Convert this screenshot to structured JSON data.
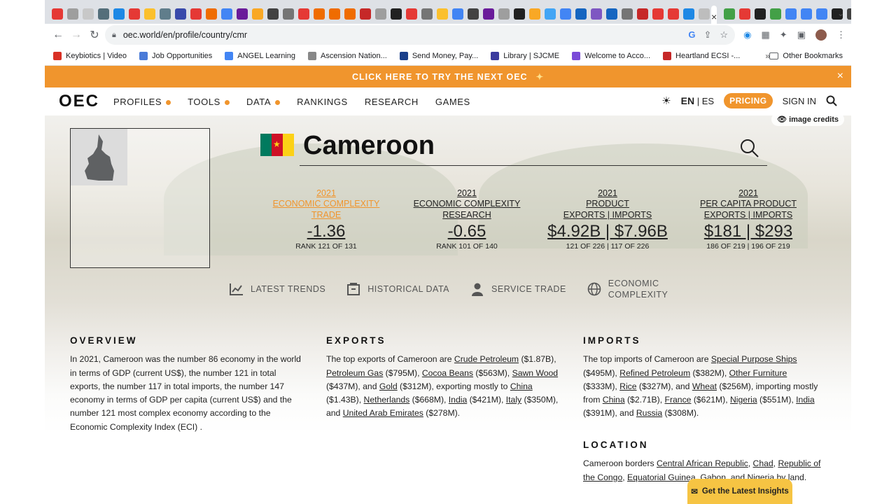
{
  "browser": {
    "active_tab_close": "×",
    "new_tab": "+",
    "tab_menu": "⌄",
    "url": "oec.world/en/profile/country/cmr",
    "bookmarks": [
      {
        "label": "Keybiotics | Video",
        "color": "#d93025"
      },
      {
        "label": "Job Opportunities",
        "color": "#4a7bd8"
      },
      {
        "label": "ANGEL Learning",
        "color": "#4285f4"
      },
      {
        "label": "Ascension Nation...",
        "color": "#888888"
      },
      {
        "label": "Send Money, Pay...",
        "color": "#1a3f8a"
      },
      {
        "label": "Library | SJCME",
        "color": "#3b3b9e"
      },
      {
        "label": "Welcome to Acco...",
        "color": "#7b4bd8"
      },
      {
        "label": "Heartland ECSI -...",
        "color": "#c62828"
      }
    ],
    "bookmarks_more": "»",
    "other_bookmarks": "Other Bookmarks"
  },
  "banner": {
    "text": "CLICK HERE TO TRY THE NEXT OEC",
    "close": "×"
  },
  "nav": {
    "logo": "OEC",
    "links": [
      "PROFILES",
      "TOOLS",
      "DATA",
      "RANKINGS",
      "RESEARCH",
      "GAMES"
    ],
    "lang_active": "EN",
    "lang_sep": " | ",
    "lang_other": "ES",
    "pricing": "PRICING",
    "sign_in": "SIGN IN"
  },
  "hero": {
    "image_credits": "image credits",
    "country": "Cameroon",
    "stats": [
      {
        "year": "2021",
        "label1": "ECONOMIC COMPLEXITY",
        "label2": "TRADE",
        "label3": "",
        "value": "-1.36",
        "rank": "RANK 121 OF 131",
        "active": true
      },
      {
        "year": "2021",
        "label1": "ECONOMIC COMPLEXITY",
        "label2": "RESEARCH",
        "label3": "",
        "value": "-0.65",
        "rank": "RANK 101 OF 140",
        "active": false
      },
      {
        "year": "2021",
        "label1": "PRODUCT",
        "label2": "EXPORTS | IMPORTS",
        "label3": "",
        "value": "$4.92B | $7.96B",
        "rank": "121 OF 226 | 117 OF 226",
        "active": false
      },
      {
        "year": "2021",
        "label1": "PER CAPITA PRODUCT",
        "label2": "EXPORTS | IMPORTS",
        "label3": "",
        "value": "$181 | $293",
        "rank": "186 OF 219 | 196 OF 219",
        "active": false
      }
    ],
    "tools": [
      "LATEST TRENDS",
      "HISTORICAL DATA",
      "SERVICE TRADE",
      "ECONOMIC COMPLEXITY"
    ]
  },
  "overview": {
    "heading": "OVERVIEW",
    "text": "In 2021, Cameroon was the number 86 economy in the world in terms of GDP (current US$), the number 121 in total exports, the number 117 in total imports, the number 147 economy in terms of GDP per capita (current US$) and the number 121 most complex economy according to the Economic Complexity Index (ECI) ."
  },
  "exports": {
    "heading": "EXPORTS",
    "t1": "The top exports of Cameroon are ",
    "l1": "Crude Petroleum",
    "v1": " ($1.87B), ",
    "l2": "Petroleum Gas",
    "v2": " ($795M), ",
    "l3": "Cocoa Beans",
    "v3": " ($563M), ",
    "l4": "Sawn Wood",
    "v4": " ($437M), and ",
    "l5": "Gold",
    "v5": " ($312M), exporting mostly to ",
    "l6": "China",
    "v6": " ($1.43B), ",
    "l7": "Netherlands",
    "v7": " ($668M), ",
    "l8": "India",
    "v8": " ($421M), ",
    "l9": "Italy",
    "v9": " ($350M), and ",
    "l10": "United Arab Emirates",
    "v10": " ($278M)."
  },
  "imports": {
    "heading": "IMPORTS",
    "t1": "The top imports of Cameroon are ",
    "l1": "Special Purpose Ships",
    "v1": " ($495M), ",
    "l2": "Refined Petroleum",
    "v2": " ($382M), ",
    "l3": "Other Furniture",
    "v3": " ($333M), ",
    "l4": "Rice",
    "v4": " ($327M), and ",
    "l5": "Wheat",
    "v5": " ($256M), importing mostly from ",
    "l6": "China",
    "v6": " ($2.71B), ",
    "l7": "France",
    "v7": " ($621M), ",
    "l8": "Nigeria",
    "v8": " ($551M), ",
    "l9": "India",
    "v9": " ($391M), and ",
    "l10": "Russia",
    "v10": " ($308M)."
  },
  "location": {
    "heading": "LOCATION",
    "t1": "Cameroon borders ",
    "l1": "Central African Republic",
    "s1": ", ",
    "l2": "Chad",
    "s2": ", ",
    "l3": "Republic of the Congo",
    "s3": ", ",
    "l4": "Equatorial Guinea",
    "s4": ", ",
    "l5": "Gabon",
    "s5": ", and ",
    "l6": "Nigeria",
    "s6": " by land."
  },
  "insights": "Get the Latest Insights",
  "colors": {
    "accent": "#f0952d",
    "insights": "#f6c443"
  }
}
